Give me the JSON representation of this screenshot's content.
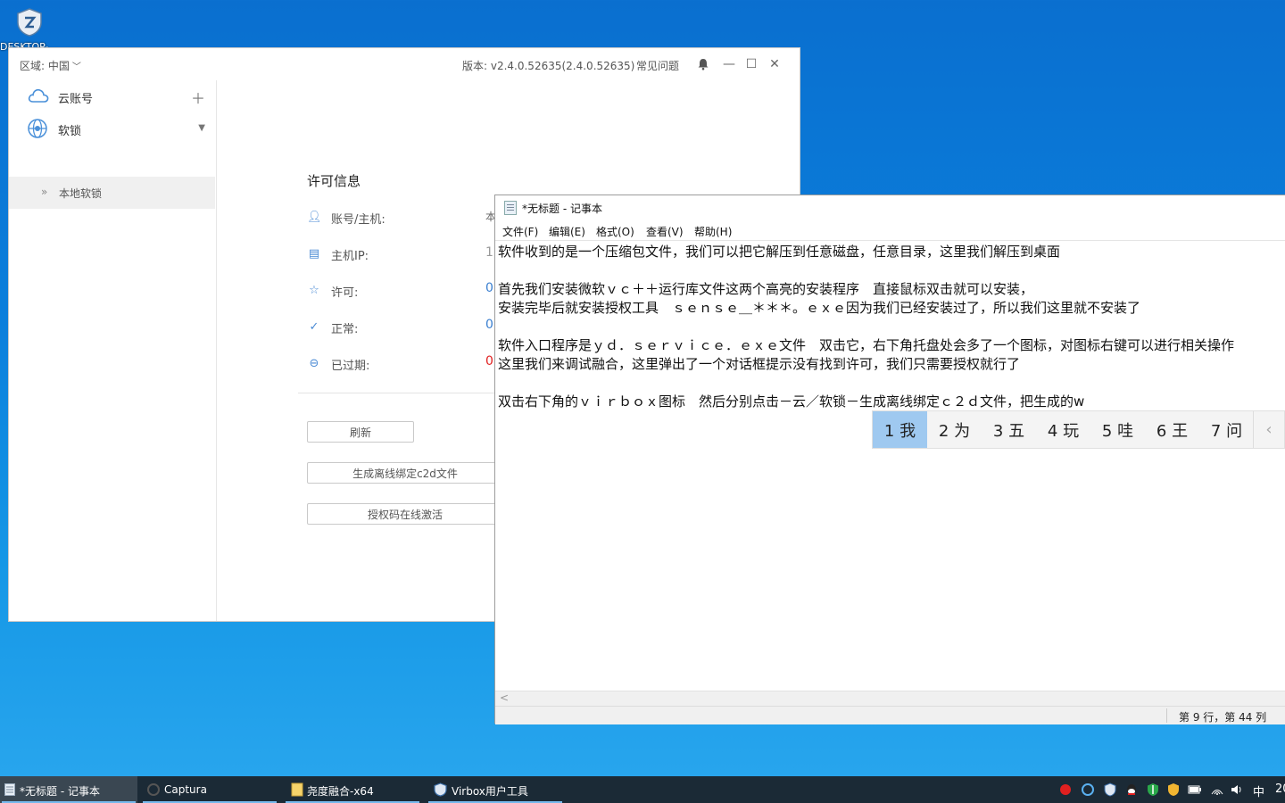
{
  "desktop": {
    "icon_label": "DESKTOP-..."
  },
  "virbox": {
    "region_label": "区域: 中国",
    "version_label": "版本: v2.4.0.52635(2.4.0.52635)",
    "faq_label": "常见问题",
    "sidebar": {
      "cloud_account": "云账号",
      "soft_lock": "软锁",
      "local_soft_lock": "本地软锁"
    },
    "license": {
      "title": "许可信息",
      "rows": [
        {
          "key": "账号/主机:",
          "value": "本"
        },
        {
          "key": "主机IP:",
          "value": "1"
        },
        {
          "key": "许可:",
          "value": "0"
        },
        {
          "key": "正常:",
          "value": "0"
        },
        {
          "key": "已过期:",
          "value": "0"
        }
      ],
      "expired_color": "#e02020",
      "value_color": "#3a7fd0"
    },
    "buttons": {
      "refresh": "刷新",
      "generate_c2d": "生成离线绑定c2d文件",
      "online_activate": "授权码在线激活"
    }
  },
  "notepad": {
    "title": "*无标题 - 记事本",
    "menu": [
      "文件(F)",
      "编辑(E)",
      "格式(O)",
      "查看(V)",
      "帮助(H)"
    ],
    "lines": [
      "软件收到的是一个压缩包文件，我们可以把它解压到任意磁盘，任意目录，这里我们解压到桌面",
      "",
      "首先我们安装微软ｖｃ＋＋运行库文件这两个高亮的安装程序　直接鼠标双击就可以安装，",
      "安装完毕后就安装授权工具　ｓｅｎｓｅ＿＊＊＊。ｅｘｅ因为我们已经安装过了，所以我们这里就不安装了",
      "",
      "软件入口程序是ｙｄ．ｓｅｒｖｉｃｅ．ｅｘｅ文件　双击它，右下角托盘处会多了一个图标，对图标右键可以进行相关操作",
      "这里我们来调试融合，这里弹出了一个对话框提示没有找到许可，我们只需要授权就行了",
      "",
      "双击右下角的ｖｉｒｂｏｘ图标　然后分别点击－云／软锁－生成离线绑定ｃ２ｄ文件，把生成的w"
    ],
    "status": "第 9 行，第 44 列"
  },
  "ime": {
    "candidates": [
      "1 我",
      "2 为",
      "3 五",
      "4 玩",
      "5 哇",
      "6 王",
      "7 问"
    ],
    "prev": "‹"
  },
  "taskbar": {
    "items": [
      {
        "label": "*无标题 - 记事本"
      },
      {
        "label": "Captura"
      },
      {
        "label": "尧度融合-x64"
      },
      {
        "label": "Virbox用户工具"
      }
    ],
    "ime_mode": "中",
    "clock": "20"
  }
}
